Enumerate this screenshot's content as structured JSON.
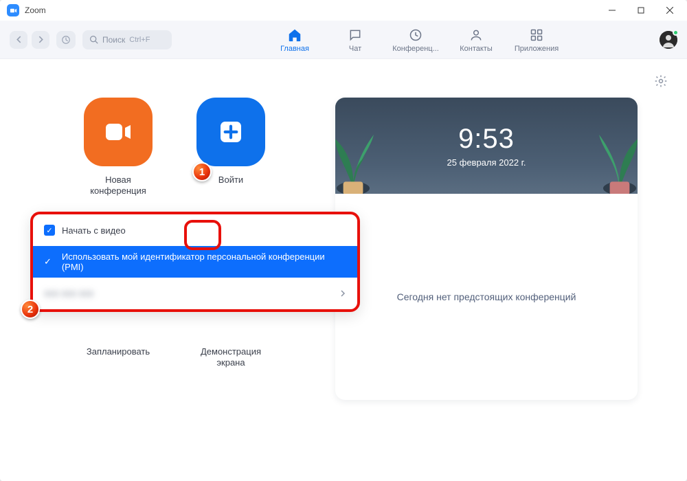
{
  "window": {
    "title": "Zoom"
  },
  "toolbar": {
    "search_label": "Поиск",
    "search_kbd": "Ctrl+F",
    "tabs": {
      "home": "Главная",
      "chat": "Чат",
      "meetings": "Конференц...",
      "contacts": "Контакты",
      "apps": "Приложения"
    }
  },
  "tiles": {
    "new_meeting": "Новая\nконференция",
    "join": "Войти",
    "schedule": "Запланировать",
    "share_screen": "Демонстрация\nэкрана"
  },
  "calendar_card": {
    "time": "9:53",
    "date": "25 февраля 2022 г.",
    "empty_msg": "Сегодня нет предстоящих конференций"
  },
  "dropdown": {
    "start_with_video": "Начать с видео",
    "use_pmi": "Использовать мой идентификатор персональной конференции (PMI)",
    "pmi_value": "000 000 000"
  },
  "annotations": {
    "one": "1",
    "two": "2"
  }
}
